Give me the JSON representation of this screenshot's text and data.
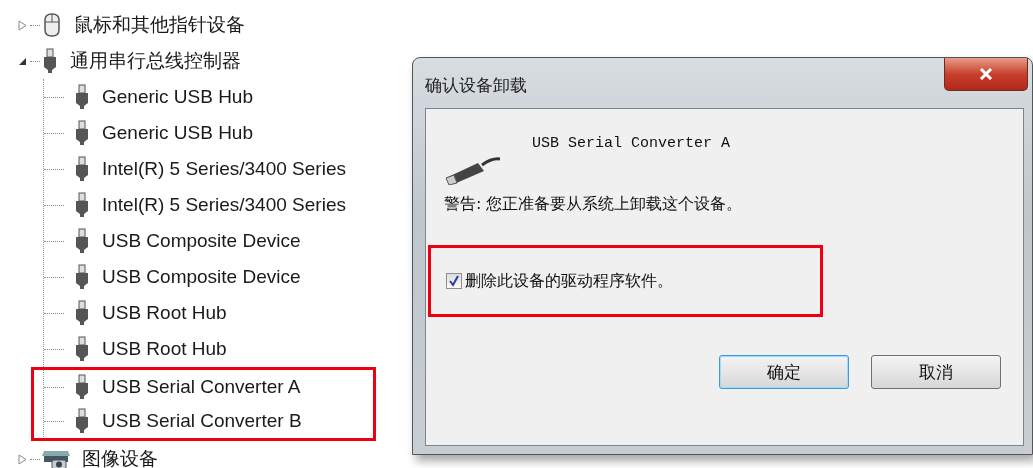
{
  "tree": [
    {
      "label": "鼠标和其他指针设备",
      "kind": "mouse",
      "expanded": false
    },
    {
      "label": "通用串行总线控制器",
      "kind": "usb",
      "expanded": true,
      "children": [
        {
          "label": "Generic USB Hub",
          "kind": "usb",
          "highlighted": false
        },
        {
          "label": "Generic USB Hub",
          "kind": "usb",
          "highlighted": false
        },
        {
          "label": "Intel(R) 5 Series/3400 Series",
          "kind": "usb",
          "highlighted": false
        },
        {
          "label": "Intel(R) 5 Series/3400 Series",
          "kind": "usb",
          "highlighted": false
        },
        {
          "label": "USB Composite Device",
          "kind": "usb",
          "highlighted": false
        },
        {
          "label": "USB Composite Device",
          "kind": "usb",
          "highlighted": false
        },
        {
          "label": "USB Root Hub",
          "kind": "usb",
          "highlighted": false
        },
        {
          "label": "USB Root Hub",
          "kind": "usb",
          "highlighted": false
        },
        {
          "label": "USB Serial Converter A",
          "kind": "usb",
          "highlighted": true
        },
        {
          "label": "USB Serial Converter B",
          "kind": "usb",
          "highlighted": true
        }
      ]
    },
    {
      "label": "图像设备",
      "kind": "imaging",
      "expanded": false
    }
  ],
  "dialog": {
    "title": "确认设备卸载",
    "device_name": "USB Serial Converter A",
    "warning": "警告: 您正准备要从系统上卸载这个设备。",
    "checkbox": {
      "label": "删除此设备的驱动程序软件。",
      "checked": true,
      "highlighted": true
    },
    "buttons": [
      {
        "label": "确定",
        "default": true
      },
      {
        "label": "取消",
        "default": false
      }
    ]
  }
}
